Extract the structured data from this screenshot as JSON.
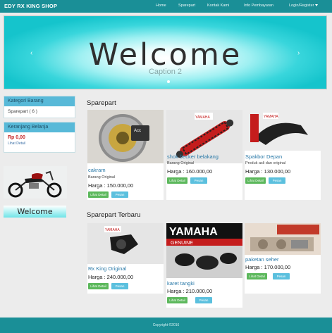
{
  "navbar": {
    "brand": "EDY RX KING SHOP",
    "items": [
      "Home",
      "Sparepart",
      "Kontak Kami",
      "Info Pembayaran",
      "Login/Register"
    ]
  },
  "carousel": {
    "title": "Welcome",
    "caption": "Caption 2",
    "prev_icon": "chevron-left",
    "next_icon": "chevron-right"
  },
  "sidebar": {
    "category_heading": "Kategori Barang",
    "category_item": "Sparepart ( 6 )",
    "cart_heading": "Keranjang Belanja",
    "cart_amount": "Rp 0,00",
    "cart_link": "Lihat Detail",
    "welcome_banner": "Welcome"
  },
  "main": {
    "section1_title": "Sparepart",
    "section2_title": "Sparepart Terbaru",
    "view_label": "Lihat Detail",
    "order_label": "Pesan",
    "cards_row1": [
      {
        "name": "cakram",
        "desc": "Barang Original",
        "price": "Harga : 150.000,00"
      },
      {
        "name": "shok becker belakang",
        "desc": "Barang Original",
        "price": "Harga : 160.000,00"
      },
      {
        "name": "Spakbor Depan",
        "desc": "Produk asli dan original",
        "price": "Harga : 130.000,00"
      }
    ],
    "cards_row2": [
      {
        "name": "Rx King Original",
        "price": "Harga : 240.000,00"
      },
      {
        "name": "karet tangki",
        "price": "Harga : 210.000,00"
      },
      {
        "name": "paketan seher",
        "price": "Harga : 170.000,00"
      }
    ],
    "image_labels": {
      "yamaha": "YAMAHA",
      "genuine": "GENUINE",
      "acc": "Acc"
    }
  },
  "footer": {
    "text": "Copyright ©2016"
  }
}
